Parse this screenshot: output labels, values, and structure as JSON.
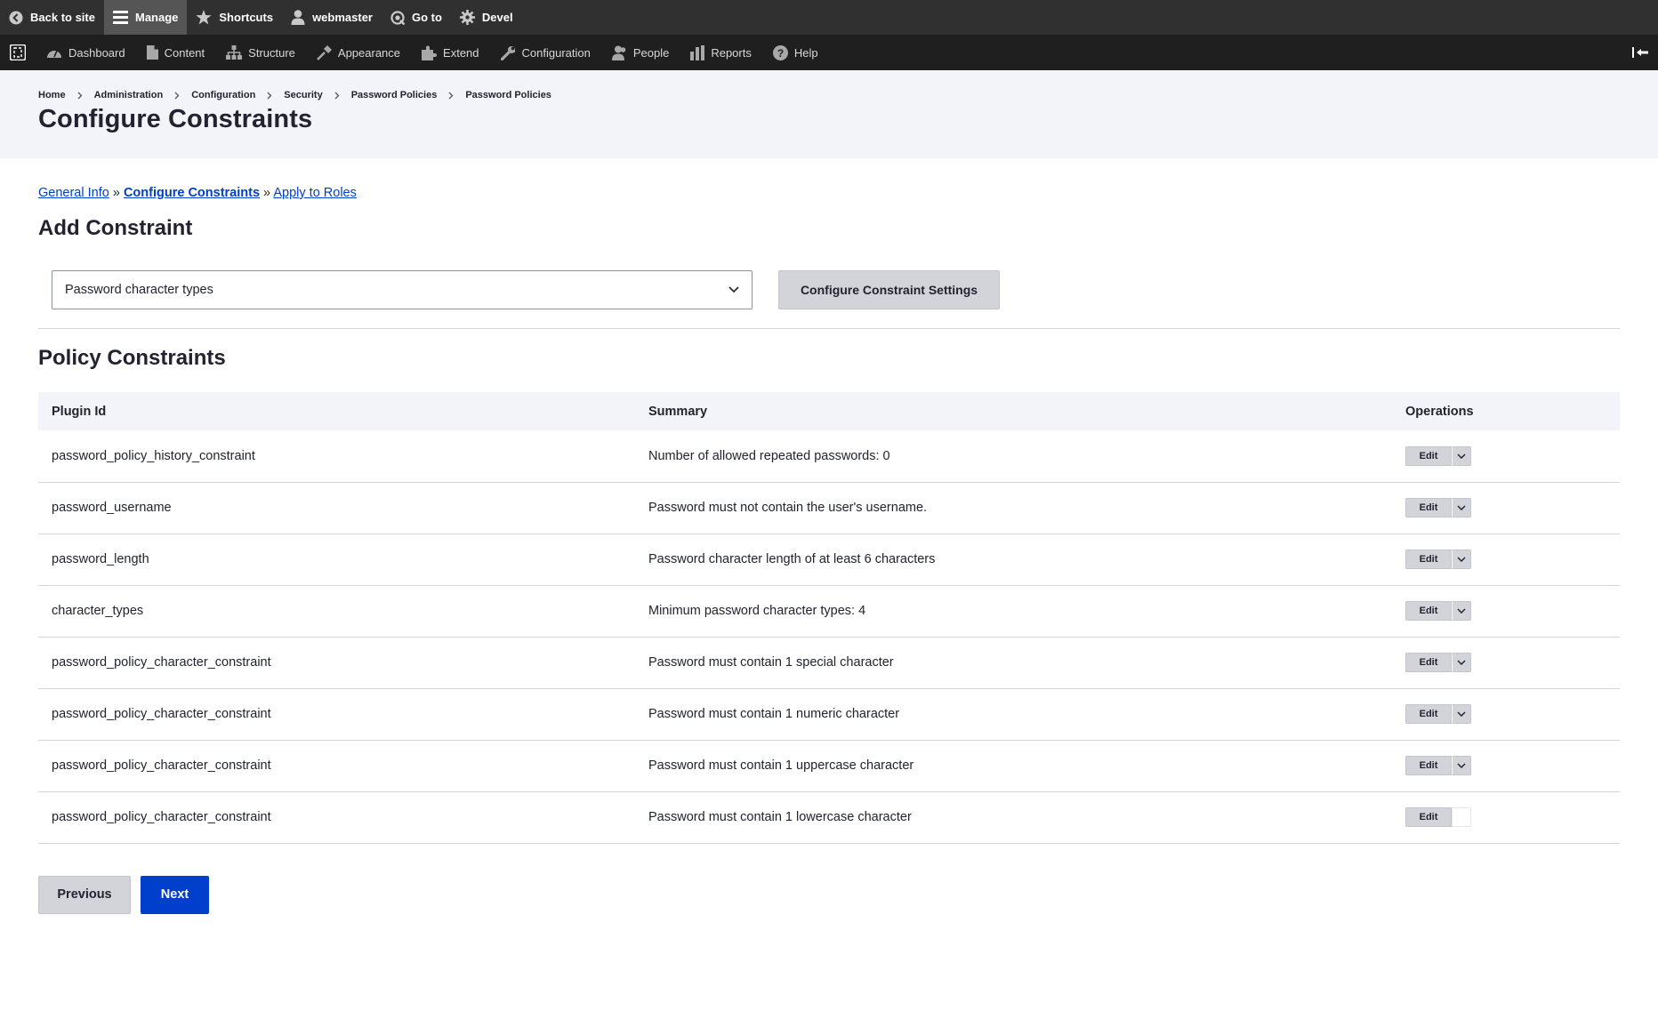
{
  "toolbar": {
    "back_label": "Back to site",
    "manage_label": "Manage",
    "shortcuts_label": "Shortcuts",
    "user_label": "webmaster",
    "goto_label": "Go to",
    "devel_label": "Devel"
  },
  "tray": {
    "items": [
      {
        "label": "Dashboard",
        "icon": "dashboard-icon"
      },
      {
        "label": "Content",
        "icon": "content-icon"
      },
      {
        "label": "Structure",
        "icon": "structure-icon"
      },
      {
        "label": "Appearance",
        "icon": "appearance-icon"
      },
      {
        "label": "Extend",
        "icon": "extend-icon"
      },
      {
        "label": "Configuration",
        "icon": "configuration-icon"
      },
      {
        "label": "People",
        "icon": "people-icon"
      },
      {
        "label": "Reports",
        "icon": "reports-icon"
      },
      {
        "label": "Help",
        "icon": "help-icon"
      }
    ]
  },
  "breadcrumb": [
    "Home",
    "Administration",
    "Configuration",
    "Security",
    "Password Policies",
    "Password Policies"
  ],
  "page": {
    "title": "Configure Constraints"
  },
  "steps": {
    "general": "General Info",
    "sep1": "»",
    "configure": "Configure Constraints",
    "sep2": "»",
    "roles": "Apply to Roles"
  },
  "add_constraint": {
    "heading": "Add Constraint",
    "select_value": "Password character types",
    "button_label": "Configure Constraint Settings"
  },
  "policy": {
    "heading": "Policy Constraints",
    "columns": [
      "Plugin Id",
      "Summary",
      "Operations"
    ],
    "edit_label": "Edit",
    "rows": [
      {
        "plugin": "password_policy_history_constraint",
        "summary": "Number of allowed repeated passwords: 0"
      },
      {
        "plugin": "password_username",
        "summary": "Password must not contain the user's username."
      },
      {
        "plugin": "password_length",
        "summary": "Password character length of at least 6 characters"
      },
      {
        "plugin": "character_types",
        "summary": "Minimum password character types: 4"
      },
      {
        "plugin": "password_policy_character_constraint",
        "summary": "Password must contain 1 special character"
      },
      {
        "plugin": "password_policy_character_constraint",
        "summary": "Password must contain 1 numeric character"
      },
      {
        "plugin": "password_policy_character_constraint",
        "summary": "Password must contain 1 uppercase character"
      },
      {
        "plugin": "password_policy_character_constraint",
        "summary": "Password must contain 1 lowercase character"
      }
    ]
  },
  "actions": {
    "previous": "Previous",
    "next": "Next"
  },
  "colors": {
    "link": "#003ecc",
    "primary_button": "#003ecc",
    "toolbar_bg": "#303030",
    "tray_bg": "#1f1f1f",
    "header_bg": "#f3f4f9"
  }
}
